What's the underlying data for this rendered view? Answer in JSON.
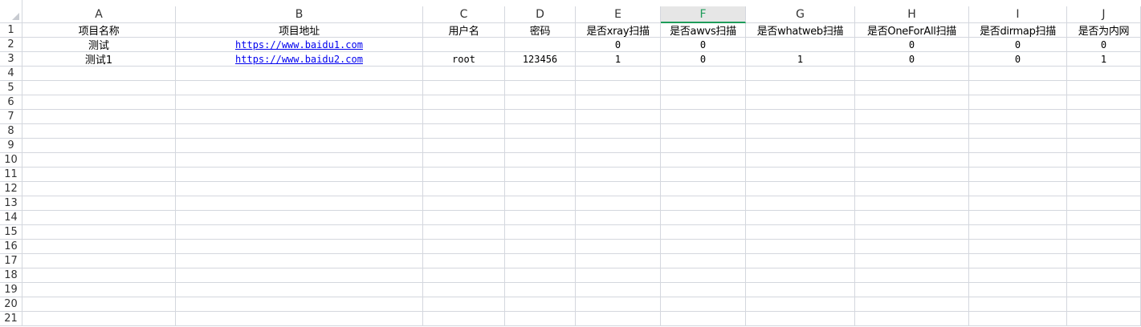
{
  "columns": [
    "A",
    "B",
    "C",
    "D",
    "E",
    "F",
    "G",
    "H",
    "I",
    "J"
  ],
  "selected_column": "F",
  "row_numbers": [
    "1",
    "2",
    "3",
    "4",
    "5",
    "6",
    "7",
    "8",
    "9",
    "10",
    "11",
    "12",
    "13",
    "14",
    "15",
    "16",
    "17",
    "18",
    "19",
    "20",
    "21"
  ],
  "header_row": [
    "项目名称",
    "项目地址",
    "用户名",
    "密码",
    "是否xray扫描",
    "是否awvs扫描",
    "是否whatweb扫描",
    "是否OneForAll扫描",
    "是否dirmap扫描",
    "是否为内网"
  ],
  "data_rows": [
    [
      "测试",
      "https://www.baidu1.com",
      "",
      "",
      "0",
      "0",
      "",
      "0",
      "0",
      "0"
    ],
    [
      "测试1",
      "https://www.baidu2.com",
      "root",
      "123456",
      "1",
      "0",
      "1",
      "0",
      "0",
      "1"
    ]
  ]
}
